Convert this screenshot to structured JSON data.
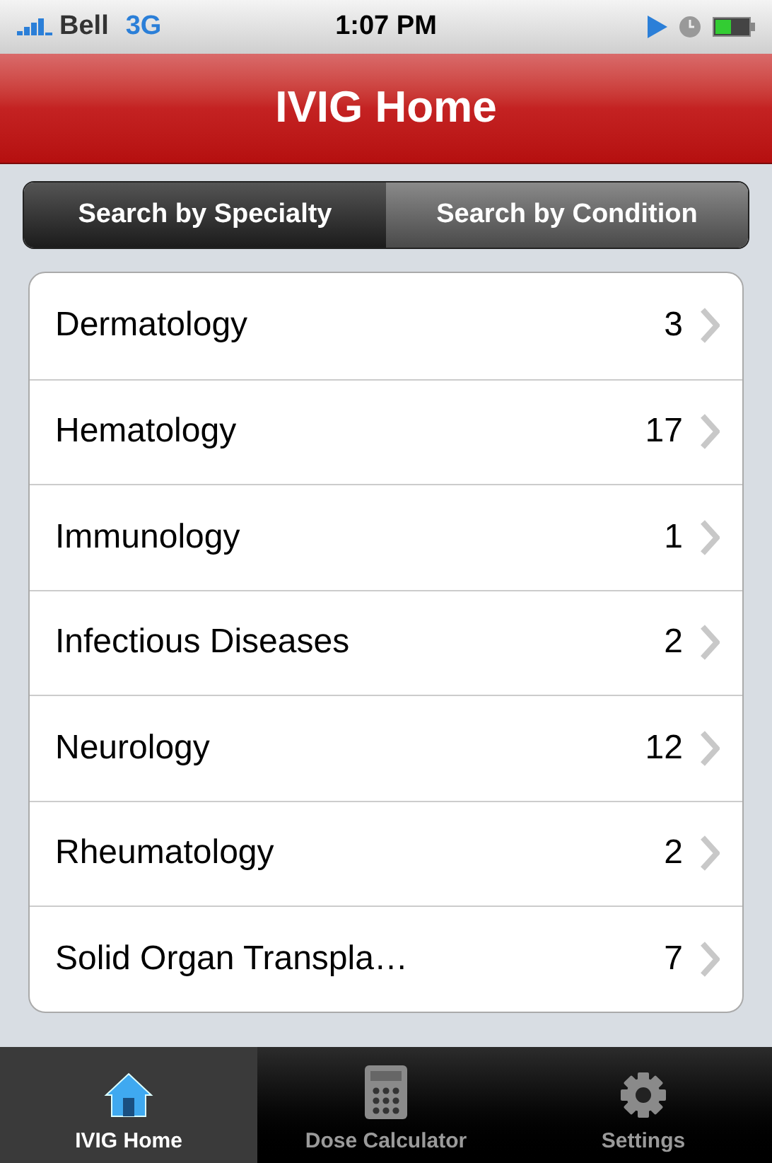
{
  "status_bar": {
    "carrier": "Bell",
    "network": "3G",
    "time": "1:07 PM"
  },
  "title": "IVIG Home",
  "segments": [
    {
      "label": "Search by Specialty",
      "selected": true
    },
    {
      "label": "Search by Condition",
      "selected": false
    }
  ],
  "specialties": [
    {
      "name": "Dermatology",
      "count": "3"
    },
    {
      "name": "Hematology",
      "count": "17"
    },
    {
      "name": "Immunology",
      "count": "1"
    },
    {
      "name": "Infectious Diseases",
      "count": "2"
    },
    {
      "name": "Neurology",
      "count": "12"
    },
    {
      "name": "Rheumatology",
      "count": "2"
    },
    {
      "name": "Solid Organ Transpla…",
      "count": "7"
    }
  ],
  "tab_bar": [
    {
      "kind": "home",
      "label": "IVIG Home",
      "selected": true
    },
    {
      "kind": "calculator",
      "label": "Dose Calculator",
      "selected": false
    },
    {
      "kind": "settings",
      "label": "Settings",
      "selected": false
    }
  ]
}
